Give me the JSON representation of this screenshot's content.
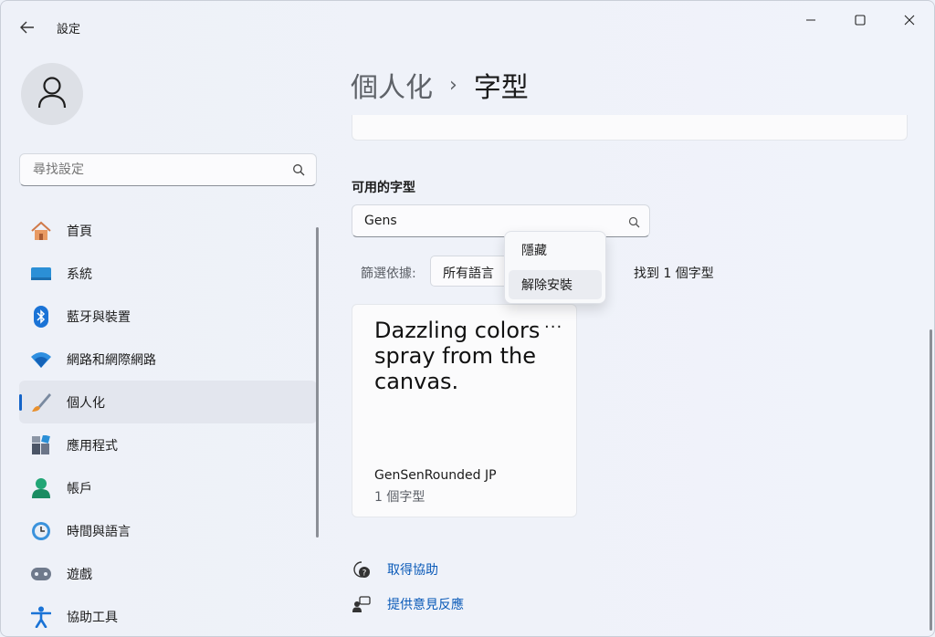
{
  "window": {
    "title": "設定",
    "icons": {
      "back": "arrow-left-icon",
      "minimize": "minimize-icon",
      "maximize": "maximize-icon",
      "close": "close-icon"
    }
  },
  "sidebar": {
    "search_placeholder": "尋找設定",
    "items": [
      {
        "label": "首頁",
        "icon": "home-icon"
      },
      {
        "label": "系統",
        "icon": "system-display-icon"
      },
      {
        "label": "藍牙與裝置",
        "icon": "bluetooth-icon"
      },
      {
        "label": "網路和網際網路",
        "icon": "wifi-icon"
      },
      {
        "label": "個人化",
        "icon": "paintbrush-icon",
        "active": true
      },
      {
        "label": "應用程式",
        "icon": "apps-icon"
      },
      {
        "label": "帳戶",
        "icon": "account-icon"
      },
      {
        "label": "時間與語言",
        "icon": "clock-globe-icon"
      },
      {
        "label": "遊戲",
        "icon": "gamepad-icon"
      },
      {
        "label": "協助工具",
        "icon": "accessibility-icon"
      }
    ]
  },
  "main": {
    "breadcrumb": {
      "parent": "個人化",
      "separator": "›",
      "current": "字型"
    },
    "available_fonts": {
      "title": "可用的字型",
      "search_value": "Gens",
      "filter_label": "篩選依據:",
      "filter_value": "所有語言",
      "found_text": "找到 1 個字型"
    },
    "context_menu": {
      "items": [
        "隱藏",
        "解除安裝"
      ]
    },
    "font_card": {
      "preview": "Dazzling colors spray from the canvas.",
      "more_label": "···",
      "name": "GenSenRounded JP",
      "count": "1 個字型"
    },
    "help_links": [
      {
        "label": "取得協助",
        "icon": "help-chat-icon"
      },
      {
        "label": "提供意見反應",
        "icon": "feedback-icon"
      }
    ]
  },
  "colors": {
    "accent": "#1464c8",
    "link": "#0a5ab8"
  }
}
